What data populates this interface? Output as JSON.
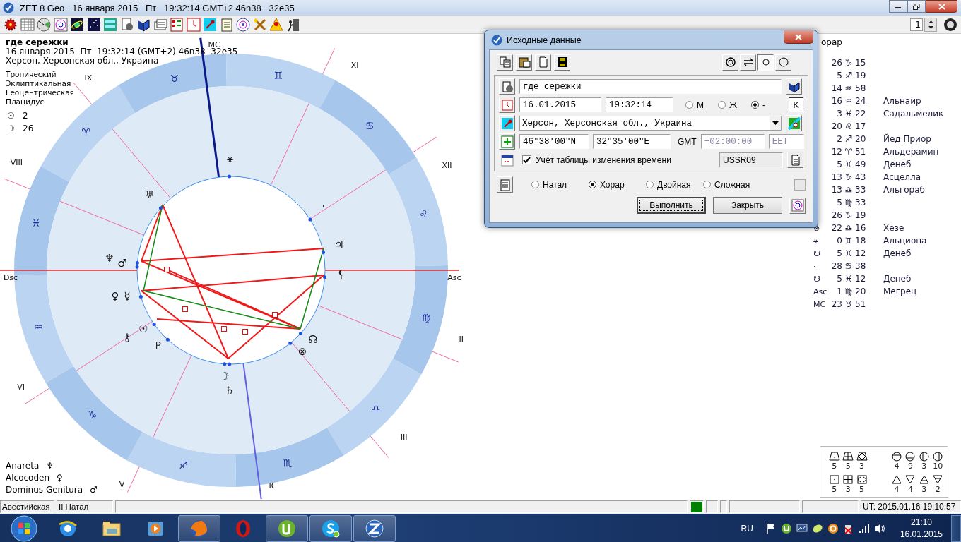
{
  "window": {
    "title": "ZET 8 Geo   16 января 2015   Пт   19:32:14 GMT+2 46n38   32e35",
    "page_number": "1"
  },
  "chart": {
    "name": "где сережки",
    "datetime": "16 января 2015  Пт  19:32:14 (GMT+2) 46n38  32e35",
    "place": "Херсон, Херсонская обл., Украина",
    "settings": [
      "Тропический",
      "Эклиптикальная",
      "Геоцентрическая",
      "Плацидус"
    ],
    "phases": [
      {
        "glyph": "☉",
        "value": "2"
      },
      {
        "glyph": "☽",
        "value": "26"
      }
    ],
    "signs": [
      "♈",
      "♉",
      "♊",
      "♋",
      "♌",
      "♍",
      "♎",
      "♏",
      "♐",
      "♑",
      "♒",
      "♓"
    ],
    "cusps": [
      "Asc",
      "II",
      "III",
      "IC",
      "V",
      "VI",
      "Dsc",
      "VIII",
      "IX",
      "MC",
      "XI",
      "XII"
    ],
    "planets": [
      {
        "glyph": "☉"
      },
      {
        "glyph": "☽"
      },
      {
        "glyph": "☿"
      },
      {
        "glyph": "♀"
      },
      {
        "glyph": "♂"
      },
      {
        "glyph": "♃"
      },
      {
        "glyph": "♄"
      },
      {
        "glyph": "♅"
      },
      {
        "glyph": "♆"
      },
      {
        "glyph": "♇"
      },
      {
        "glyph": "☊"
      },
      {
        "glyph": "⚸"
      },
      {
        "glyph": "⚷"
      },
      {
        "glyph": "⊗"
      },
      {
        "glyph": "⚹"
      },
      {
        "glyph": "·"
      }
    ],
    "rulers": [
      {
        "label": "Anareta",
        "glyph": "♆"
      },
      {
        "label": "Alcocoden",
        "glyph": "♀"
      },
      {
        "label": "Dominus Genitura",
        "glyph": "♂"
      }
    ]
  },
  "positions": {
    "title": "орар",
    "rows": [
      {
        "deg": "26",
        "sign": "♑",
        "min": "15"
      },
      {
        "deg": "5",
        "sign": "♐",
        "min": "19"
      },
      {
        "deg": "14",
        "sign": "♒",
        "min": "58"
      },
      {
        "deg": "16",
        "sign": "♒",
        "min": "24",
        "star": "Альнаир"
      },
      {
        "deg": "3",
        "sign": "♓",
        "min": "22",
        "star": "Садальмелик"
      },
      {
        "deg": "20",
        "sign": "♌",
        "min": "17"
      },
      {
        "deg": "2",
        "sign": "♐",
        "min": "20",
        "star": "Йед Приор"
      },
      {
        "deg": "12",
        "sign": "♈",
        "min": "51",
        "star": "Альдерамин"
      },
      {
        "deg": "5",
        "sign": "♓",
        "min": "49",
        "star": "Денеб"
      },
      {
        "deg": "13",
        "sign": "♑",
        "min": "43",
        "star": "Асцелла"
      },
      {
        "deg": "13",
        "sign": "♎",
        "min": "33",
        "star": "Альгораб"
      },
      {
        "deg": "5",
        "sign": "♍",
        "min": "33"
      },
      {
        "deg": "26",
        "sign": "♑",
        "min": "19"
      },
      {
        "glyph": "⊗",
        "deg": "22",
        "sign": "♎",
        "min": "16",
        "star": "Хезе"
      },
      {
        "glyph": "⚹",
        "deg": "0",
        "sign": "♊",
        "min": "18",
        "star": "Альциона"
      },
      {
        "glyph": "☋",
        "deg": "5",
        "sign": "♓",
        "min": "12",
        "star": "Денеб"
      },
      {
        "glyph": "·",
        "deg": "28",
        "sign": "♋",
        "min": "38"
      },
      {
        "glyph": "☋",
        "deg": "5",
        "sign": "♓",
        "min": "12",
        "star": "Денеб"
      },
      {
        "glyph": "Asc",
        "deg": "1",
        "sign": "♍",
        "min": "20",
        "star": "Мегрец"
      },
      {
        "glyph": "MC",
        "deg": "23",
        "sign": "♉",
        "min": "51"
      }
    ]
  },
  "dignities": {
    "rows": [
      [
        "5",
        "5",
        "3",
        "4",
        "9",
        "3",
        "10"
      ],
      [
        "5",
        "3",
        "5",
        "4",
        "4",
        "3",
        "2"
      ]
    ]
  },
  "dialog": {
    "title": "Исходные данные",
    "view_buttons": [
      {
        "selected": false
      },
      {
        "selected": false
      },
      {
        "selected": true
      },
      {
        "selected": false
      }
    ],
    "name": "где сережки",
    "date": "16.01.2015",
    "time": "19:32:14",
    "gender": [
      {
        "label": "М",
        "selected": false
      },
      {
        "label": "Ж",
        "selected": false
      },
      {
        "label": "-",
        "selected": true
      }
    ],
    "k_button": "K",
    "place": "Херсон, Херсонская обл., Украина",
    "latitude": "46°38'00\"N",
    "longitude": "32°35'00\"E",
    "gmt_label": "GMT",
    "gmt": {
      "value": "+02:00:00",
      "disabled": true
    },
    "zone": {
      "value": "EET",
      "disabled": true
    },
    "dst": {
      "label": "Учёт таблицы изменения времени",
      "checked": true
    },
    "dst_table": "USSR09",
    "chart_types": [
      {
        "label": "Натал",
        "selected": false
      },
      {
        "label": "Хорар",
        "selected": true
      },
      {
        "label": "Двойная",
        "selected": false
      },
      {
        "label": "Сложная",
        "selected": false
      }
    ],
    "buttons": [
      {
        "label": "Выполнить",
        "default": true
      },
      {
        "label": "Закрыть",
        "default": false
      }
    ]
  },
  "status_bar": {
    "panes": [
      "Авестийская",
      "II Натал"
    ],
    "indicator": {
      "on": true
    },
    "ut": "UT: 2015.01.16 19:10:57"
  },
  "taskbar": {
    "apps": [
      {
        "running": false
      },
      {
        "running": false
      },
      {
        "running": false
      },
      {
        "running": true
      },
      {
        "running": false
      },
      {
        "running": true
      },
      {
        "running": true
      },
      {
        "running": true
      }
    ],
    "language": "RU",
    "time": "21:10",
    "date": "16.01.2015"
  }
}
